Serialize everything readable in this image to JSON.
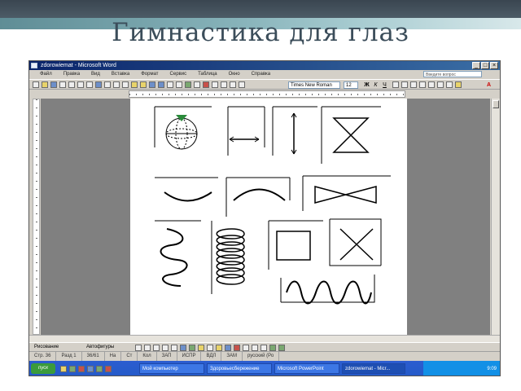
{
  "slide": {
    "title": "Гимнастика для глаз"
  },
  "window": {
    "title": "zdorowiemat - Microsoft Word",
    "buttons": [
      "_",
      "□",
      "×"
    ]
  },
  "menu": {
    "items": [
      "Файл",
      "Правка",
      "Вид",
      "Вставка",
      "Формат",
      "Сервис",
      "Таблица",
      "Окно",
      "Справка"
    ],
    "ask_placeholder": "Введите вопрос"
  },
  "toolbar": {
    "font_name": "Times New Roman",
    "font_size": "12",
    "bold": "Ж",
    "italic": "К",
    "underline": "Ч",
    "font_color_label": "A"
  },
  "drawing_toolbar": {
    "draw_label": "Рисование",
    "autoshapes_label": "Автофигуры"
  },
  "status": {
    "page": "Стр. 36",
    "section": "Разд 1",
    "page_of": "36/61",
    "position": "На",
    "line": "Ст",
    "col": "Кол",
    "rec": "ЗАП",
    "trk": "ИСПР",
    "ext": "ВДЛ",
    "ovr": "ЗАМ",
    "lang": "русский (Ро"
  },
  "taskbar": {
    "start_label": "пуск",
    "tasks": [
      {
        "label": "Мой компьютер",
        "active": false
      },
      {
        "label": "Здоровьесбережение",
        "active": false
      },
      {
        "label": "Microsoft PowerPoint",
        "active": false
      },
      {
        "label": "zdorowiemat - Micr...",
        "active": true
      }
    ],
    "clock": "9:09"
  }
}
